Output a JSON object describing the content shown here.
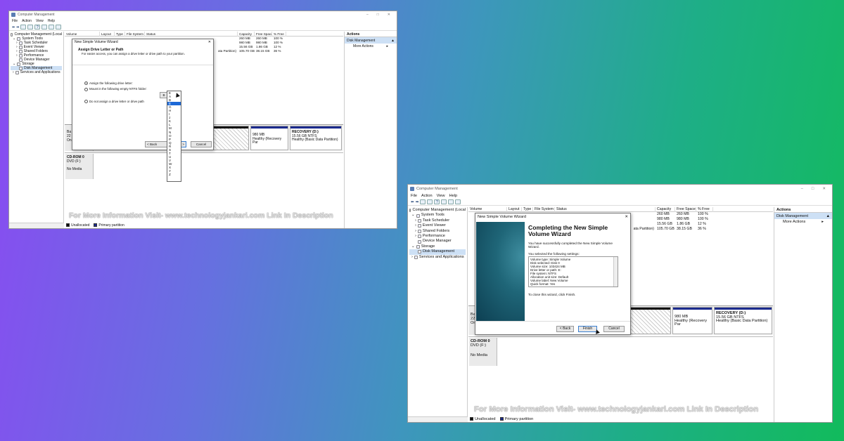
{
  "colors": {
    "primary_partition": "#1b2a8c",
    "unallocated": "#111111",
    "selection": "#1c68d6"
  },
  "win1": {
    "title": "Computer Management",
    "menu": [
      "File",
      "Action",
      "View",
      "Help"
    ],
    "tree": [
      {
        "label": "Computer Management (Local",
        "icon": "computer-icon"
      },
      {
        "label": "System Tools",
        "icon": "tools-icon"
      },
      {
        "label": "Task Scheduler",
        "icon": "clock-icon"
      },
      {
        "label": "Event Viewer",
        "icon": "event-icon"
      },
      {
        "label": "Shared Folders",
        "icon": "folder-icon"
      },
      {
        "label": "Performance",
        "icon": "performance-icon"
      },
      {
        "label": "Device Manager",
        "icon": "device-icon"
      },
      {
        "label": "Storage",
        "icon": "storage-icon"
      },
      {
        "label": "Disk Management",
        "icon": "disk-icon"
      },
      {
        "label": "Services and Applications",
        "icon": "services-icon"
      }
    ],
    "columns": [
      "Volume",
      "Layout",
      "Type",
      "File System",
      "Status",
      "Capacity",
      "Free Space",
      "% Free"
    ],
    "rows": [
      {
        "status": "",
        "capacity": "260 MB",
        "free": "260 MB",
        "pct": "100 %"
      },
      {
        "status": "",
        "capacity": "980 MB",
        "free": "980 MB",
        "pct": "100 %"
      },
      {
        "status": "",
        "capacity": "15.56 GB",
        "free": "1.86 GB",
        "pct": "12 %"
      },
      {
        "status": "ata Partition)",
        "capacity": "105.70 GB",
        "free": "38.15 GB",
        "pct": "36 %"
      }
    ],
    "disk_partitions": [
      {
        "line1": "980 MB",
        "line2": "Healthy (Recovery Par"
      },
      {
        "line1": "RECOVERY  (D:)",
        "line2": "15.56 GB NTFS",
        "line3": "Healthy (Basic Data Partition)"
      }
    ],
    "disk_label_fragments": [
      "Ba",
      "22",
      "On"
    ],
    "cdrom": {
      "name": "CD-ROM 0",
      "type": "DVD (F:)",
      "status": "No Media"
    },
    "legend": [
      "Unallocated",
      "Primary partition"
    ],
    "actions": {
      "header": "Actions",
      "selected": "Disk Management",
      "more": "More Actions"
    },
    "watermark": "For More Information Visit- www.technologyjankari.com Link In Description",
    "dialog": {
      "title": "New Simple Volume Wizard",
      "heading": "Assign Drive Letter or Path",
      "subheading": "For easier access, you can assign a drive letter or drive path to your partition.",
      "option_assign": "Assign the following drive letter:",
      "option_mount": "Mount in the following empty NTFS folder:",
      "option_none": "Do not assign a drive letter or drive path",
      "browse_fragment": "B",
      "selected_letter": "E",
      "letters": [
        "E",
        "A",
        "B",
        "G",
        "H",
        "I",
        "J",
        "K",
        "L",
        "M",
        "N",
        "O",
        "P",
        "Q",
        "R",
        "S",
        "T",
        "U",
        "V",
        "W",
        "X",
        "Y",
        "Z"
      ],
      "back": "< Back",
      "next": "Next >",
      "next_fragment": "xt >",
      "cancel": "Cancel"
    }
  },
  "win2": {
    "title": "Computer Management",
    "menu": [
      "File",
      "Action",
      "View",
      "Help"
    ],
    "tree": [
      {
        "label": "Computer Management (Local",
        "icon": "computer-icon"
      },
      {
        "label": "System Tools",
        "icon": "tools-icon"
      },
      {
        "label": "Task Scheduler",
        "icon": "clock-icon"
      },
      {
        "label": "Event Viewer",
        "icon": "event-icon"
      },
      {
        "label": "Shared Folders",
        "icon": "folder-icon"
      },
      {
        "label": "Performance",
        "icon": "performance-icon"
      },
      {
        "label": "Device Manager",
        "icon": "device-icon"
      },
      {
        "label": "Storage",
        "icon": "storage-icon"
      },
      {
        "label": "Disk Management",
        "icon": "disk-icon"
      },
      {
        "label": "Services and Applications",
        "icon": "services-icon"
      }
    ],
    "columns": [
      "Volume",
      "Layout",
      "Type",
      "File System",
      "Status",
      "Capacity",
      "Free Space",
      "% Free"
    ],
    "rows": [
      {
        "status": "",
        "capacity": "260 MB",
        "free": "260 MB",
        "pct": "100 %"
      },
      {
        "status": "",
        "capacity": "980 MB",
        "free": "980 MB",
        "pct": "100 %"
      },
      {
        "status": "",
        "capacity": "15.56 GB",
        "free": "1.86 GB",
        "pct": "12 %"
      },
      {
        "status": "ata Partition)",
        "capacity": "105.70 GB",
        "free": "38.15 GB",
        "pct": "36 %"
      }
    ],
    "disk_partitions": [
      {
        "line1": "980 MB",
        "line2": "Healthy (Recovery Par"
      },
      {
        "line1": "RECOVERY  (D:)",
        "line2": "15.56 GB NTFS",
        "line3": "Healthy (Basic Data Partition)"
      }
    ],
    "disk_label_fragments": [
      "Ba",
      "22",
      "On"
    ],
    "cdrom": {
      "name": "CD-ROM 0",
      "type": "DVD (F:)",
      "status": "No Media"
    },
    "legend": [
      "Unallocated",
      "Primary partition"
    ],
    "actions": {
      "header": "Actions",
      "selected": "Disk Management",
      "more": "More Actions"
    },
    "watermark": "For More Information Visit- www.technologyjankari.com Link In Description",
    "dialog": {
      "title": "New Simple Volume Wizard",
      "heading": "Completing the New Simple Volume Wizard",
      "intro": "You have successfully completed the New Simple Volume Wizard.",
      "selected_label": "You selected the following settings:",
      "settings": [
        "Volume type: Simple Volume",
        "Disk selected: Disk 0",
        "Volume size: 103424 MB",
        "Drive letter or path: E:",
        "File system: NTFS",
        "Allocation unit size: Default",
        "Volume label: New Volume",
        "Quick format: Yes"
      ],
      "close_text": "To close this wizard, click Finish.",
      "back": "< Back",
      "finish": "Finish",
      "cancel": "Cancel"
    }
  }
}
